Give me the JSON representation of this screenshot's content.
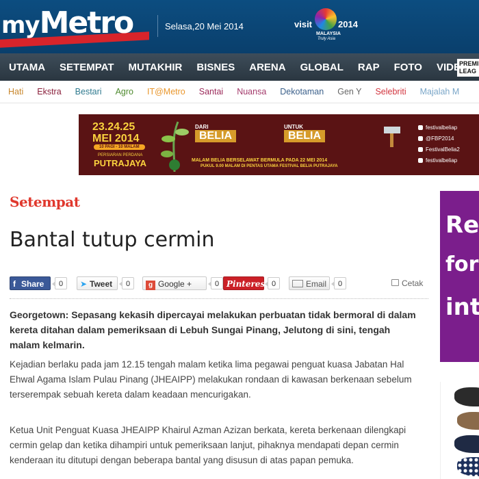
{
  "header": {
    "logo_my": "my",
    "logo_metro": "Metro",
    "date": "Selasa,20 Mei 2014",
    "visit_label": "visit",
    "visit_year": "2014",
    "visit_country": "MALAYSIA",
    "visit_tagline": "Truly Asia"
  },
  "main_nav": {
    "items": [
      "UTAMA",
      "SETEMPAT",
      "MUTAKHIR",
      "BISNES",
      "ARENA",
      "GLOBAL",
      "RAP",
      "FOTO",
      "VIDEO"
    ],
    "premier": "PREMI LEAG"
  },
  "sub_nav": {
    "items": [
      {
        "label": "Hati",
        "color": "#c8862b"
      },
      {
        "label": "Ekstra",
        "color": "#8a1f3b"
      },
      {
        "label": "Bestari",
        "color": "#2f7a8f"
      },
      {
        "label": "Agro",
        "color": "#4e8a2e"
      },
      {
        "label": "IT@Metro",
        "color": "#e9962b"
      },
      {
        "label": "Santai",
        "color": "#9b2a5a"
      },
      {
        "label": "Nuansa",
        "color": "#a33a6b"
      },
      {
        "label": "Dekotaman",
        "color": "#3a5f8a"
      },
      {
        "label": "Gen Y",
        "color": "#666666"
      },
      {
        "label": "Selebriti",
        "color": "#d2353f"
      },
      {
        "label": "Majalah M",
        "color": "#7aa6c8"
      }
    ]
  },
  "banner": {
    "dates": "23.24.25",
    "month": "MEI 2014",
    "hours": "10 PAGI - 10 MALAM",
    "venue_small": "PERSIARAN PERDANA",
    "venue": "PUTRAJAYA",
    "dari": "DARI",
    "belia1": "BELIA",
    "untuk": "UNTUK",
    "belia2": "BELIA",
    "tagline": "MALAM BELIA BERSELAWAT BERMULA PADA 22 MEI 2014",
    "tagline2": "PUKUL 9.00 MALAM DI PENTAS UTAMA FESTIVAL BELIA PUTRAJAYA",
    "social": [
      "festivalbeliap",
      "@FBP2014",
      "FestivalBelia2",
      "festivalbeliap"
    ]
  },
  "article": {
    "section": "Setempat",
    "title": "Bantal tutup cermin",
    "lead": "Georgetown: Sepasang kekasih dipercayai melakukan perbuatan tidak bermoral di dalam kereta ditahan dalam pemeriksaan di Lebuh Sungai Pinang, Jelutong di sini, tengah malam kelmarin.",
    "para1": "Kejadian berlaku pada jam 12.15 tengah malam ketika lima pegawai penguat kuasa Jabatan Hal Ehwal Agama Islam Pulau Pinang (JHEAIPP) melakukan rondaan di kawasan berkenaan sebelum terserempak sebuah kereta dalam keadaan mencurigakan.",
    "para2": "Ketua Unit Penguat Kuasa JHEAIPP Khairul Azman Azizan berkata, kereta berkenaan dilengkapi cermin gelap dan ketika dihampiri untuk pemeriksaan lanjut, pihaknya mendapati depan cermin kenderaan itu ditutupi dengan beberapa bantal yang disusun di atas papan pemuka."
  },
  "share": {
    "facebook": {
      "label": "Share",
      "count": "0",
      "color": "#3b5998"
    },
    "twitter": {
      "label": "Tweet",
      "count": "0"
    },
    "google": {
      "label": "Google +",
      "count": "0"
    },
    "pinterest": {
      "label": "Pinterest",
      "count": "0"
    },
    "email": {
      "label": "Email",
      "count": "0"
    },
    "print": "Cetak"
  },
  "ads": {
    "ad1_lines": [
      "Re",
      "for",
      "int"
    ]
  },
  "colors": {
    "header_bg": "#0c4d80",
    "nav_bg": "#2f3c47",
    "accent_red": "#e0382d",
    "banner_bg": "#5a1314"
  }
}
